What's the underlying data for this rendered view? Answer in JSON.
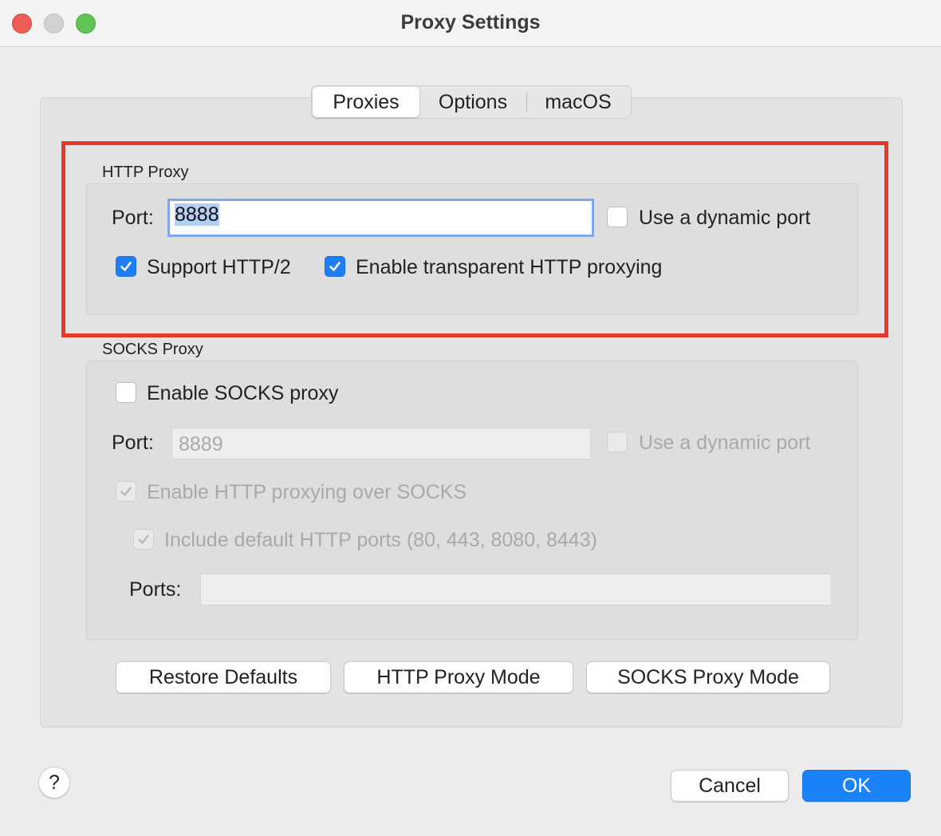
{
  "window": {
    "title": "Proxy Settings"
  },
  "tabs": [
    {
      "label": "Proxies",
      "active": true
    },
    {
      "label": "Options",
      "active": false
    },
    {
      "label": "macOS",
      "active": false
    }
  ],
  "http_proxy": {
    "section_label": "HTTP Proxy",
    "port_label": "Port:",
    "port_value": "8888",
    "dynamic_port_label": "Use a dynamic port",
    "dynamic_port_checked": false,
    "http2_label": "Support HTTP/2",
    "http2_checked": true,
    "transparent_label": "Enable transparent HTTP proxying",
    "transparent_checked": true
  },
  "socks_proxy": {
    "section_label": "SOCKS Proxy",
    "enable_label": "Enable SOCKS proxy",
    "enable_checked": false,
    "port_label": "Port:",
    "port_value": "8889",
    "dynamic_port_label": "Use a dynamic port",
    "http_over_socks_label": "Enable HTTP proxying over SOCKS",
    "http_over_socks_checked": true,
    "include_default_ports_label": "Include default HTTP ports (80, 443, 8080, 8443)",
    "include_default_ports_checked": true,
    "ports_label": "Ports:",
    "ports_value": ""
  },
  "buttons": {
    "restore_defaults": "Restore Defaults",
    "http_proxy_mode": "HTTP Proxy Mode",
    "socks_proxy_mode": "SOCKS Proxy Mode",
    "cancel": "Cancel",
    "ok": "OK",
    "help": "?"
  },
  "colors": {
    "accent": "#1b82f7",
    "highlight_border": "#e53a2a",
    "window_bg": "#ececec"
  }
}
